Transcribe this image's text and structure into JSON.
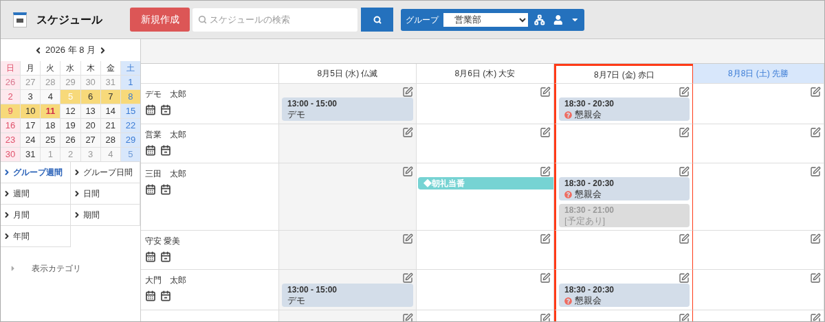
{
  "header": {
    "title": "スケジュール",
    "new_button": "新規作成",
    "search": {
      "placeholder": "スケジュールの検索"
    },
    "group": {
      "label": "グループ",
      "value": "営業部"
    }
  },
  "sidebar": {
    "month_label": "2026 年 8 月",
    "weekdays": [
      {
        "label": "日",
        "kind": "sunday"
      },
      {
        "label": "月",
        "kind": "weekday"
      },
      {
        "label": "火",
        "kind": "weekday"
      },
      {
        "label": "水",
        "kind": "weekday"
      },
      {
        "label": "木",
        "kind": "weekday"
      },
      {
        "label": "金",
        "kind": "weekday"
      },
      {
        "label": "土",
        "kind": "saturday"
      }
    ],
    "weeks": [
      [
        {
          "d": "26",
          "outside": true,
          "in_range": false,
          "holiday": false,
          "today": false
        },
        {
          "d": "27",
          "outside": true,
          "in_range": false,
          "holiday": false,
          "today": false
        },
        {
          "d": "28",
          "outside": true,
          "in_range": false,
          "holiday": false,
          "today": false
        },
        {
          "d": "29",
          "outside": true,
          "in_range": false,
          "holiday": false,
          "today": false
        },
        {
          "d": "30",
          "outside": true,
          "in_range": false,
          "holiday": false,
          "today": false
        },
        {
          "d": "31",
          "outside": true,
          "in_range": false,
          "holiday": false,
          "today": false
        },
        {
          "d": "1",
          "outside": false,
          "in_range": false,
          "holiday": false,
          "today": false
        }
      ],
      [
        {
          "d": "2",
          "outside": false,
          "in_range": false,
          "holiday": false,
          "today": false
        },
        {
          "d": "3",
          "outside": false,
          "in_range": false,
          "holiday": false,
          "today": false
        },
        {
          "d": "4",
          "outside": false,
          "in_range": false,
          "holiday": false,
          "today": false
        },
        {
          "d": "5",
          "outside": false,
          "in_range": true,
          "holiday": false,
          "today": true
        },
        {
          "d": "6",
          "outside": false,
          "in_range": true,
          "holiday": false,
          "today": false
        },
        {
          "d": "7",
          "outside": false,
          "in_range": true,
          "holiday": false,
          "today": false
        },
        {
          "d": "8",
          "outside": false,
          "in_range": true,
          "holiday": false,
          "today": false
        }
      ],
      [
        {
          "d": "9",
          "outside": false,
          "in_range": true,
          "holiday": false,
          "today": false
        },
        {
          "d": "10",
          "outside": false,
          "in_range": true,
          "holiday": false,
          "today": false
        },
        {
          "d": "11",
          "outside": false,
          "in_range": true,
          "holiday": true,
          "today": false
        },
        {
          "d": "12",
          "outside": false,
          "in_range": false,
          "holiday": false,
          "today": false
        },
        {
          "d": "13",
          "outside": false,
          "in_range": false,
          "holiday": false,
          "today": false
        },
        {
          "d": "14",
          "outside": false,
          "in_range": false,
          "holiday": false,
          "today": false
        },
        {
          "d": "15",
          "outside": false,
          "in_range": false,
          "holiday": false,
          "today": false
        }
      ],
      [
        {
          "d": "16",
          "outside": false,
          "in_range": false,
          "holiday": false,
          "today": false
        },
        {
          "d": "17",
          "outside": false,
          "in_range": false,
          "holiday": false,
          "today": false
        },
        {
          "d": "18",
          "outside": false,
          "in_range": false,
          "holiday": false,
          "today": false
        },
        {
          "d": "19",
          "outside": false,
          "in_range": false,
          "holiday": false,
          "today": false
        },
        {
          "d": "20",
          "outside": false,
          "in_range": false,
          "holiday": false,
          "today": false
        },
        {
          "d": "21",
          "outside": false,
          "in_range": false,
          "holiday": false,
          "today": false
        },
        {
          "d": "22",
          "outside": false,
          "in_range": false,
          "holiday": false,
          "today": false
        }
      ],
      [
        {
          "d": "23",
          "outside": false,
          "in_range": false,
          "holiday": false,
          "today": false
        },
        {
          "d": "24",
          "outside": false,
          "in_range": false,
          "holiday": false,
          "today": false
        },
        {
          "d": "25",
          "outside": false,
          "in_range": false,
          "holiday": false,
          "today": false
        },
        {
          "d": "26",
          "outside": false,
          "in_range": false,
          "holiday": false,
          "today": false
        },
        {
          "d": "27",
          "outside": false,
          "in_range": false,
          "holiday": false,
          "today": false
        },
        {
          "d": "28",
          "outside": false,
          "in_range": false,
          "holiday": false,
          "today": false
        },
        {
          "d": "29",
          "outside": false,
          "in_range": false,
          "holiday": false,
          "today": false
        }
      ],
      [
        {
          "d": "30",
          "outside": false,
          "in_range": false,
          "holiday": false,
          "today": false
        },
        {
          "d": "31",
          "outside": false,
          "in_range": false,
          "holiday": false,
          "today": false
        },
        {
          "d": "1",
          "outside": true,
          "in_range": false,
          "holiday": false,
          "today": false
        },
        {
          "d": "2",
          "outside": true,
          "in_range": false,
          "holiday": false,
          "today": false
        },
        {
          "d": "3",
          "outside": true,
          "in_range": false,
          "holiday": false,
          "today": false
        },
        {
          "d": "4",
          "outside": true,
          "in_range": false,
          "holiday": false,
          "today": false
        },
        {
          "d": "5",
          "outside": true,
          "in_range": false,
          "holiday": false,
          "today": false
        }
      ]
    ],
    "views": [
      {
        "label": "グループ週間",
        "selected": true
      },
      {
        "label": "グループ日間",
        "selected": false
      },
      {
        "label": "週間",
        "selected": false
      },
      {
        "label": "日間",
        "selected": false
      },
      {
        "label": "月間",
        "selected": false
      },
      {
        "label": "期間",
        "selected": false
      },
      {
        "label": "年間",
        "selected": false
      }
    ],
    "category_toggle": {
      "label": "表示カテゴリ",
      "expanded": false
    }
  },
  "days": [
    {
      "label": "8月5日 (水) 仏滅",
      "kind": "weekday",
      "today": true,
      "highlighted": false
    },
    {
      "label": "8月6日 (木) 大安",
      "kind": "weekday",
      "today": false,
      "highlighted": false
    },
    {
      "label": "8月7日 (金) 赤口",
      "kind": "weekday",
      "today": false,
      "highlighted": true
    },
    {
      "label": "8月8日 (土) 先勝",
      "kind": "saturday",
      "today": false,
      "highlighted": false
    }
  ],
  "members": [
    {
      "name": "デモ　太郎",
      "cells": [
        {
          "events": [
            {
              "kind": "appointment",
              "time": "13:00 - 15:00",
              "title": "デモ",
              "unconfirmed": false
            }
          ]
        },
        {},
        {
          "events": [
            {
              "kind": "appointment",
              "time": "18:30 - 20:30",
              "title": "懇親会",
              "unconfirmed": true
            }
          ]
        },
        {}
      ]
    },
    {
      "name": "営業　太郎",
      "cells": [
        {},
        {},
        {},
        {}
      ]
    },
    {
      "name": "三田　太郎",
      "cells": [
        {},
        {
          "events": [
            {
              "kind": "all_day",
              "title": "◆朝礼当番"
            }
          ]
        },
        {
          "events": [
            {
              "kind": "appointment",
              "time": "18:30 - 20:30",
              "title": "懇親会",
              "unconfirmed": true
            },
            {
              "kind": "busy",
              "time": "18:30 - 21:00",
              "title": "[予定あり]"
            }
          ]
        },
        {}
      ]
    },
    {
      "name": "守安 愛美",
      "cells": [
        {},
        {},
        {},
        {}
      ]
    },
    {
      "name": "大門　太郎",
      "cells": [
        {
          "events": [
            {
              "kind": "appointment",
              "time": "13:00 - 15:00",
              "title": "デモ",
              "unconfirmed": false
            }
          ]
        },
        {},
        {
          "events": [
            {
              "kind": "appointment",
              "time": "18:30 - 20:30",
              "title": "懇親会",
              "unconfirmed": true
            }
          ]
        },
        {}
      ]
    }
  ]
}
